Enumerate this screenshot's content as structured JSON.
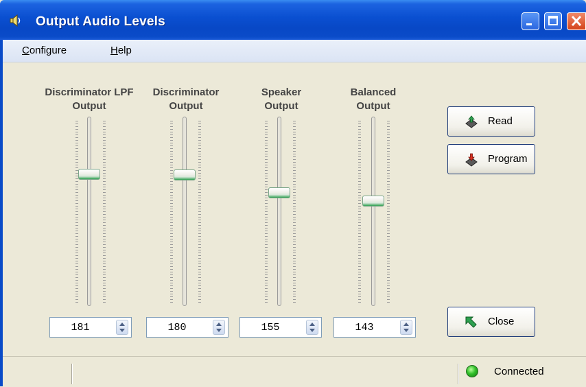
{
  "window": {
    "title": "Output Audio Levels",
    "icon": "speaker-icon"
  },
  "menu": {
    "configure": {
      "underline": "C",
      "rest": "onfigure"
    },
    "help": {
      "underline": "H",
      "rest": "elp"
    }
  },
  "sliders": [
    {
      "name": "discriminator-lpf-output",
      "label_line1": "Discriminator LPF",
      "label_line2": "Output",
      "value": "181"
    },
    {
      "name": "discriminator-output",
      "label_line1": "Discriminator",
      "label_line2": "Output",
      "value": "180"
    },
    {
      "name": "speaker-output",
      "label_line1": "Speaker",
      "label_line2": "Output",
      "value": "155"
    },
    {
      "name": "balanced-output",
      "label_line1": "Balanced",
      "label_line2": "Output",
      "value": "143"
    }
  ],
  "buttons": {
    "read": "Read",
    "program": "Program",
    "close": "Close"
  },
  "status": {
    "connection": "Connected",
    "led_color": "#32c02a"
  },
  "colors": {
    "titlebar": "#0a4fd0",
    "accent_green": "#2ea050"
  }
}
